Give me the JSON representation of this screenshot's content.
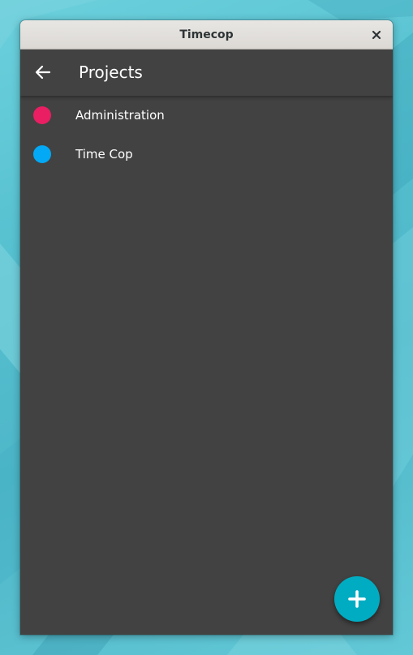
{
  "window": {
    "title": "Timecop",
    "close_icon": "close-icon"
  },
  "appbar": {
    "back_icon": "arrow-back-icon",
    "title": "Projects"
  },
  "projects": [
    {
      "name": "Administration",
      "color": "#e91e63"
    },
    {
      "name": "Time Cop",
      "color": "#03a9f4"
    }
  ],
  "fab": {
    "icon": "add-icon",
    "color": "#00acc1"
  },
  "theme": {
    "surface": "#424242",
    "on_surface": "#ffffff",
    "titlebar_text": "#2e3436"
  }
}
